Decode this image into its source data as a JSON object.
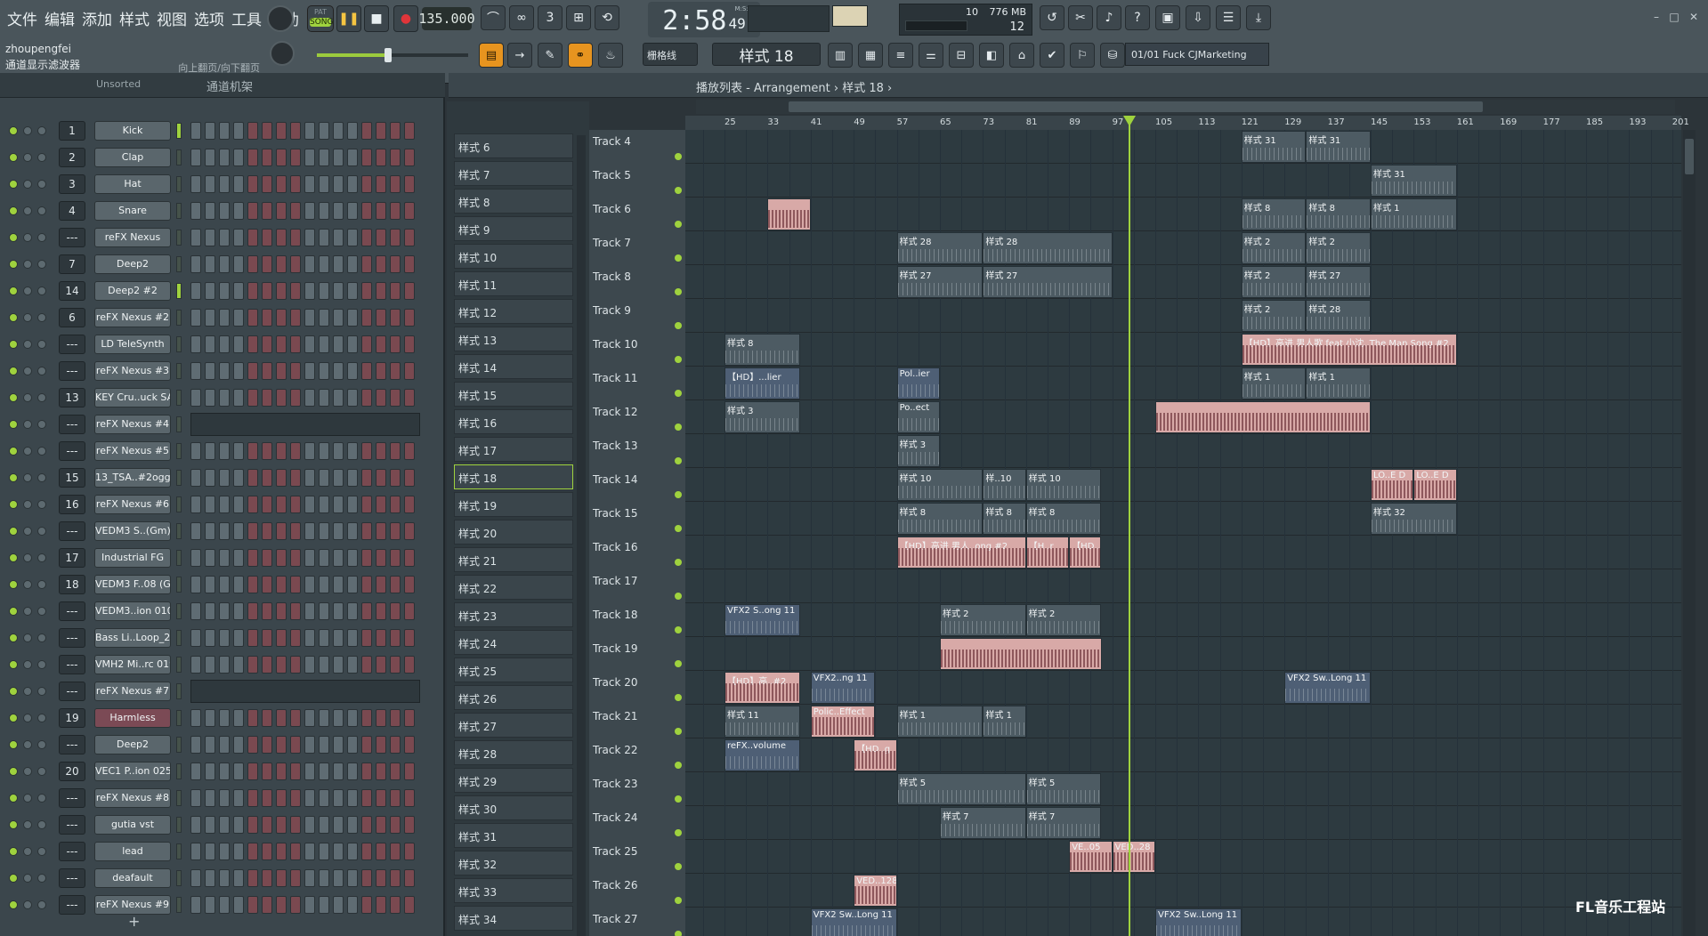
{
  "menu": [
    "文件",
    "编辑",
    "添加",
    "样式",
    "视图",
    "选项",
    "工具",
    "帮助"
  ],
  "hint": {
    "user": "zhoupengfei",
    "text": "通道显示滤波器",
    "scroll": "向上翻页/向下翻页"
  },
  "transport": {
    "pat": "PAT",
    "song": "SONG",
    "tempo": "135.000"
  },
  "clock": {
    "main": "2:58",
    "frac": "49",
    "unit": "M:S:CS"
  },
  "cpu": {
    "cpu": "10",
    "mem": "776 MB",
    "poly": "12"
  },
  "toolbar2": {
    "snap": "栅格线",
    "pattern": "样式 18",
    "hint": "01/01  Fuck CJMarketing"
  },
  "rack": {
    "filter": "Unsorted",
    "title": "通道机架",
    "add": "+",
    "channels": [
      {
        "num": "1",
        "name": "Kick",
        "type": "steps",
        "sel": true
      },
      {
        "num": "2",
        "name": "Clap",
        "type": "steps",
        "sel": false
      },
      {
        "num": "3",
        "name": "Hat",
        "type": "steps",
        "sel": false
      },
      {
        "num": "4",
        "name": "Snare",
        "type": "steps",
        "sel": false
      },
      {
        "num": "---",
        "name": "reFX Nexus",
        "type": "steps",
        "sel": false
      },
      {
        "num": "7",
        "name": "Deep2",
        "type": "steps",
        "sel": false
      },
      {
        "num": "14",
        "name": "Deep2 #2",
        "type": "steps",
        "sel": true
      },
      {
        "num": "6",
        "name": "reFX Nexus #2",
        "type": "steps",
        "sel": false
      },
      {
        "num": "---",
        "name": "LD TeleSynth",
        "type": "steps",
        "sel": false
      },
      {
        "num": "---",
        "name": "reFX Nexus #3",
        "type": "steps",
        "sel": false
      },
      {
        "num": "13",
        "name": "KEY Cru..uck SA",
        "type": "steps",
        "sel": false
      },
      {
        "num": "---",
        "name": "reFX Nexus #4",
        "type": "piano",
        "sel": false
      },
      {
        "num": "---",
        "name": "reFX Nexus #5",
        "type": "steps",
        "sel": false
      },
      {
        "num": "15",
        "name": "13_TSA..#2ogg",
        "type": "steps",
        "sel": false
      },
      {
        "num": "16",
        "name": "reFX Nexus #6",
        "type": "steps",
        "sel": false
      },
      {
        "num": "---",
        "name": "VEDM3 S..(Gm)",
        "type": "steps",
        "sel": false
      },
      {
        "num": "17",
        "name": "Industrial FG",
        "type": "steps",
        "sel": false
      },
      {
        "num": "18",
        "name": "VEDM3 F..08 (G)",
        "type": "steps",
        "sel": false
      },
      {
        "num": "---",
        "name": "VEDM3..ion 010",
        "type": "steps",
        "sel": false
      },
      {
        "num": "---",
        "name": "Bass Li..Loop_2",
        "type": "steps",
        "sel": false
      },
      {
        "num": "---",
        "name": "VMH2 Mi..rc 019",
        "type": "steps",
        "sel": false
      },
      {
        "num": "---",
        "name": "reFX Nexus #7",
        "type": "piano",
        "sel": false
      },
      {
        "num": "19",
        "name": "Harmless",
        "type": "steps",
        "sel": false,
        "red": true
      },
      {
        "num": "---",
        "name": "Deep2",
        "type": "steps",
        "sel": false
      },
      {
        "num": "20",
        "name": "VEC1 P..ion 025",
        "type": "steps",
        "sel": false
      },
      {
        "num": "---",
        "name": "reFX Nexus #8",
        "type": "steps",
        "sel": false
      },
      {
        "num": "---",
        "name": "gutia vst",
        "type": "steps",
        "sel": false
      },
      {
        "num": "---",
        "name": "lead",
        "type": "steps",
        "sel": false
      },
      {
        "num": "---",
        "name": "deafault",
        "type": "steps",
        "sel": false
      },
      {
        "num": "---",
        "name": "reFX Nexus #9",
        "type": "steps",
        "sel": false
      }
    ]
  },
  "patterns": [
    "样式 6",
    "样式 7",
    "样式 8",
    "样式 9",
    "样式 10",
    "样式 11",
    "样式 12",
    "样式 13",
    "样式 14",
    "样式 15",
    "样式 16",
    "样式 17",
    "样式 18",
    "样式 19",
    "样式 20",
    "样式 21",
    "样式 22",
    "样式 23",
    "样式 24",
    "样式 25",
    "样式 26",
    "样式 27",
    "样式 28",
    "样式 29",
    "样式 30",
    "样式 31",
    "样式 32",
    "样式 33",
    "样式 34"
  ],
  "selected_pattern_index": 12,
  "playlist": {
    "title": "播放列表 - Arrangement › 样式 18 ›",
    "ruler": [
      "25",
      "33",
      "41",
      "49",
      "57",
      "65",
      "73",
      "81",
      "89",
      "97",
      "105",
      "113",
      "121",
      "129",
      "137",
      "145",
      "153",
      "161",
      "169",
      "177",
      "185",
      "193",
      "201"
    ],
    "tracks": [
      "Track 4",
      "Track 5",
      "Track 6",
      "Track 7",
      "Track 8",
      "Track 9",
      "Track 10",
      "Track 11",
      "Track 12",
      "Track 13",
      "Track 14",
      "Track 15",
      "Track 16",
      "Track 17",
      "Track 18",
      "Track 19",
      "Track 20",
      "Track 21",
      "Track 22",
      "Track 23",
      "Track 24",
      "Track 25",
      "Track 26",
      "Track 27"
    ],
    "clips": [
      {
        "track": 0,
        "bar": 121,
        "len": 12,
        "label": "样式 31",
        "type": "pattern"
      },
      {
        "track": 0,
        "bar": 133,
        "len": 12,
        "label": "样式 31",
        "type": "pattern"
      },
      {
        "track": 1,
        "bar": 145,
        "len": 16,
        "label": "样式 31",
        "type": "pattern"
      },
      {
        "track": 2,
        "bar": 33,
        "len": 8,
        "label": "",
        "type": "audio"
      },
      {
        "track": 2,
        "bar": 121,
        "len": 12,
        "label": "样式 8",
        "type": "pattern"
      },
      {
        "track": 2,
        "bar": 133,
        "len": 12,
        "label": "样式 8",
        "type": "pattern"
      },
      {
        "track": 2,
        "bar": 145,
        "len": 16,
        "label": "样式 1",
        "type": "pattern"
      },
      {
        "track": 3,
        "bar": 57,
        "len": 16,
        "label": "样式 28",
        "type": "pattern"
      },
      {
        "track": 3,
        "bar": 73,
        "len": 24,
        "label": "样式 28",
        "type": "pattern"
      },
      {
        "track": 3,
        "bar": 121,
        "len": 12,
        "label": "样式 2",
        "type": "pattern"
      },
      {
        "track": 3,
        "bar": 133,
        "len": 12,
        "label": "样式 2",
        "type": "pattern"
      },
      {
        "track": 4,
        "bar": 57,
        "len": 16,
        "label": "样式 27",
        "type": "pattern"
      },
      {
        "track": 4,
        "bar": 73,
        "len": 24,
        "label": "样式 27",
        "type": "pattern"
      },
      {
        "track": 4,
        "bar": 121,
        "len": 12,
        "label": "样式 2",
        "type": "pattern"
      },
      {
        "track": 4,
        "bar": 133,
        "len": 12,
        "label": "样式 27",
        "type": "pattern"
      },
      {
        "track": 5,
        "bar": 121,
        "len": 12,
        "label": "样式 2",
        "type": "pattern"
      },
      {
        "track": 5,
        "bar": 133,
        "len": 12,
        "label": "样式 28",
        "type": "pattern"
      },
      {
        "track": 6,
        "bar": 25,
        "len": 14,
        "label": "样式 8",
        "type": "pattern"
      },
      {
        "track": 6,
        "bar": 121,
        "len": 40,
        "label": "【HD】高进 男人歌 feat 小沈..The Man Song #2",
        "type": "audio"
      },
      {
        "track": 7,
        "bar": 25,
        "len": 14,
        "label": "【HD】...lier",
        "type": "auto"
      },
      {
        "track": 7,
        "bar": 57,
        "len": 8,
        "label": "Pol..ier",
        "type": "auto"
      },
      {
        "track": 7,
        "bar": 121,
        "len": 12,
        "label": "样式 1",
        "type": "pattern"
      },
      {
        "track": 7,
        "bar": 133,
        "len": 12,
        "label": "样式 1",
        "type": "pattern"
      },
      {
        "track": 8,
        "bar": 25,
        "len": 14,
        "label": "样式 3",
        "type": "pattern"
      },
      {
        "track": 8,
        "bar": 57,
        "len": 8,
        "label": "Po..ect",
        "type": "pattern"
      },
      {
        "track": 8,
        "bar": 105,
        "len": 40,
        "label": "",
        "type": "audio"
      },
      {
        "track": 9,
        "bar": 57,
        "len": 8,
        "label": "样式 3",
        "type": "pattern"
      },
      {
        "track": 10,
        "bar": 57,
        "len": 16,
        "label": "样式 10",
        "type": "pattern"
      },
      {
        "track": 10,
        "bar": 73,
        "len": 8,
        "label": "样..10",
        "type": "pattern"
      },
      {
        "track": 10,
        "bar": 81,
        "len": 14,
        "label": "样式 10",
        "type": "pattern"
      },
      {
        "track": 10,
        "bar": 145,
        "len": 8,
        "label": "LO..E D",
        "type": "audio"
      },
      {
        "track": 10,
        "bar": 153,
        "len": 8,
        "label": "LO..E D",
        "type": "audio"
      },
      {
        "track": 11,
        "bar": 57,
        "len": 16,
        "label": "样式 8",
        "type": "pattern"
      },
      {
        "track": 11,
        "bar": 73,
        "len": 8,
        "label": "样式 8",
        "type": "pattern"
      },
      {
        "track": 11,
        "bar": 81,
        "len": 14,
        "label": "样式 8",
        "type": "pattern"
      },
      {
        "track": 11,
        "bar": 145,
        "len": 16,
        "label": "样式 32",
        "type": "pattern"
      },
      {
        "track": 12,
        "bar": 57,
        "len": 24,
        "label": "【HD】高进 男人..ong #2",
        "type": "audio"
      },
      {
        "track": 12,
        "bar": 81,
        "len": 8,
        "label": "【H..r",
        "type": "audio"
      },
      {
        "track": 12,
        "bar": 89,
        "len": 6,
        "label": "【HD..",
        "type": "audio"
      },
      {
        "track": 14,
        "bar": 25,
        "len": 14,
        "label": "VFX2 S..ong 11",
        "type": "auto"
      },
      {
        "track": 14,
        "bar": 65,
        "len": 16,
        "label": "样式 2",
        "type": "pattern"
      },
      {
        "track": 14,
        "bar": 81,
        "len": 14,
        "label": "样式 2",
        "type": "pattern"
      },
      {
        "track": 15,
        "bar": 65,
        "len": 30,
        "label": "",
        "type": "audio"
      },
      {
        "track": 16,
        "bar": 25,
        "len": 14,
        "label": "【HD】高..#2",
        "type": "audio"
      },
      {
        "track": 16,
        "bar": 41,
        "len": 12,
        "label": "VFX2..ng 11",
        "type": "auto"
      },
      {
        "track": 16,
        "bar": 129,
        "len": 16,
        "label": "VFX2 Sw..Long 11",
        "type": "auto"
      },
      {
        "track": 17,
        "bar": 25,
        "len": 14,
        "label": "样式 11",
        "type": "pattern"
      },
      {
        "track": 17,
        "bar": 41,
        "len": 12,
        "label": "Polic..Effect",
        "type": "audio"
      },
      {
        "track": 17,
        "bar": 57,
        "len": 16,
        "label": "样式 1",
        "type": "pattern"
      },
      {
        "track": 17,
        "bar": 73,
        "len": 8,
        "label": "样式 1",
        "type": "pattern"
      },
      {
        "track": 18,
        "bar": 25,
        "len": 14,
        "label": "reFX..volume",
        "type": "auto"
      },
      {
        "track": 18,
        "bar": 49,
        "len": 8,
        "label": "【HD..g",
        "type": "audio"
      },
      {
        "track": 19,
        "bar": 57,
        "len": 24,
        "label": "样式 5",
        "type": "pattern"
      },
      {
        "track": 19,
        "bar": 81,
        "len": 14,
        "label": "样式 5",
        "type": "pattern"
      },
      {
        "track": 20,
        "bar": 65,
        "len": 16,
        "label": "样式 7",
        "type": "pattern"
      },
      {
        "track": 20,
        "bar": 81,
        "len": 14,
        "label": "样式 7",
        "type": "pattern"
      },
      {
        "track": 21,
        "bar": 89,
        "len": 8,
        "label": "VE..05",
        "type": "audio"
      },
      {
        "track": 21,
        "bar": 97,
        "len": 8,
        "label": "VED..28",
        "type": "audio"
      },
      {
        "track": 22,
        "bar": 49,
        "len": 8,
        "label": "VED..128",
        "type": "audio"
      },
      {
        "track": 23,
        "bar": 41,
        "len": 16,
        "label": "VFX2 Sw..Long 11",
        "type": "auto"
      },
      {
        "track": 23,
        "bar": 105,
        "len": 16,
        "label": "VFX2 Sw..Long 11",
        "type": "auto"
      }
    ]
  },
  "watermark": "FL音乐工程站"
}
